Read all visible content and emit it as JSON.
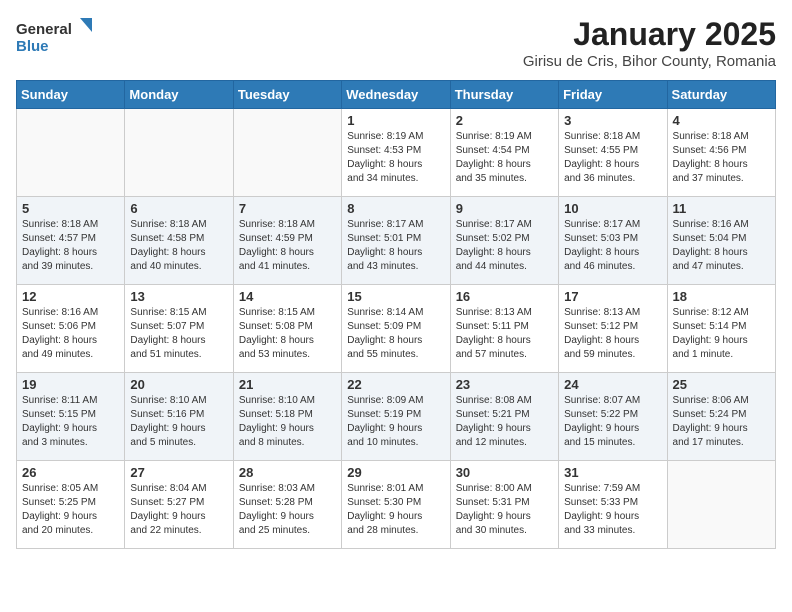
{
  "header": {
    "logo_general": "General",
    "logo_blue": "Blue",
    "month": "January 2025",
    "location": "Girisu de Cris, Bihor County, Romania"
  },
  "weekdays": [
    "Sunday",
    "Monday",
    "Tuesday",
    "Wednesday",
    "Thursday",
    "Friday",
    "Saturday"
  ],
  "weeks": [
    [
      {
        "day": "",
        "info": ""
      },
      {
        "day": "",
        "info": ""
      },
      {
        "day": "",
        "info": ""
      },
      {
        "day": "1",
        "info": "Sunrise: 8:19 AM\nSunset: 4:53 PM\nDaylight: 8 hours\nand 34 minutes."
      },
      {
        "day": "2",
        "info": "Sunrise: 8:19 AM\nSunset: 4:54 PM\nDaylight: 8 hours\nand 35 minutes."
      },
      {
        "day": "3",
        "info": "Sunrise: 8:18 AM\nSunset: 4:55 PM\nDaylight: 8 hours\nand 36 minutes."
      },
      {
        "day": "4",
        "info": "Sunrise: 8:18 AM\nSunset: 4:56 PM\nDaylight: 8 hours\nand 37 minutes."
      }
    ],
    [
      {
        "day": "5",
        "info": "Sunrise: 8:18 AM\nSunset: 4:57 PM\nDaylight: 8 hours\nand 39 minutes."
      },
      {
        "day": "6",
        "info": "Sunrise: 8:18 AM\nSunset: 4:58 PM\nDaylight: 8 hours\nand 40 minutes."
      },
      {
        "day": "7",
        "info": "Sunrise: 8:18 AM\nSunset: 4:59 PM\nDaylight: 8 hours\nand 41 minutes."
      },
      {
        "day": "8",
        "info": "Sunrise: 8:17 AM\nSunset: 5:01 PM\nDaylight: 8 hours\nand 43 minutes."
      },
      {
        "day": "9",
        "info": "Sunrise: 8:17 AM\nSunset: 5:02 PM\nDaylight: 8 hours\nand 44 minutes."
      },
      {
        "day": "10",
        "info": "Sunrise: 8:17 AM\nSunset: 5:03 PM\nDaylight: 8 hours\nand 46 minutes."
      },
      {
        "day": "11",
        "info": "Sunrise: 8:16 AM\nSunset: 5:04 PM\nDaylight: 8 hours\nand 47 minutes."
      }
    ],
    [
      {
        "day": "12",
        "info": "Sunrise: 8:16 AM\nSunset: 5:06 PM\nDaylight: 8 hours\nand 49 minutes."
      },
      {
        "day": "13",
        "info": "Sunrise: 8:15 AM\nSunset: 5:07 PM\nDaylight: 8 hours\nand 51 minutes."
      },
      {
        "day": "14",
        "info": "Sunrise: 8:15 AM\nSunset: 5:08 PM\nDaylight: 8 hours\nand 53 minutes."
      },
      {
        "day": "15",
        "info": "Sunrise: 8:14 AM\nSunset: 5:09 PM\nDaylight: 8 hours\nand 55 minutes."
      },
      {
        "day": "16",
        "info": "Sunrise: 8:13 AM\nSunset: 5:11 PM\nDaylight: 8 hours\nand 57 minutes."
      },
      {
        "day": "17",
        "info": "Sunrise: 8:13 AM\nSunset: 5:12 PM\nDaylight: 8 hours\nand 59 minutes."
      },
      {
        "day": "18",
        "info": "Sunrise: 8:12 AM\nSunset: 5:14 PM\nDaylight: 9 hours\nand 1 minute."
      }
    ],
    [
      {
        "day": "19",
        "info": "Sunrise: 8:11 AM\nSunset: 5:15 PM\nDaylight: 9 hours\nand 3 minutes."
      },
      {
        "day": "20",
        "info": "Sunrise: 8:10 AM\nSunset: 5:16 PM\nDaylight: 9 hours\nand 5 minutes."
      },
      {
        "day": "21",
        "info": "Sunrise: 8:10 AM\nSunset: 5:18 PM\nDaylight: 9 hours\nand 8 minutes."
      },
      {
        "day": "22",
        "info": "Sunrise: 8:09 AM\nSunset: 5:19 PM\nDaylight: 9 hours\nand 10 minutes."
      },
      {
        "day": "23",
        "info": "Sunrise: 8:08 AM\nSunset: 5:21 PM\nDaylight: 9 hours\nand 12 minutes."
      },
      {
        "day": "24",
        "info": "Sunrise: 8:07 AM\nSunset: 5:22 PM\nDaylight: 9 hours\nand 15 minutes."
      },
      {
        "day": "25",
        "info": "Sunrise: 8:06 AM\nSunset: 5:24 PM\nDaylight: 9 hours\nand 17 minutes."
      }
    ],
    [
      {
        "day": "26",
        "info": "Sunrise: 8:05 AM\nSunset: 5:25 PM\nDaylight: 9 hours\nand 20 minutes."
      },
      {
        "day": "27",
        "info": "Sunrise: 8:04 AM\nSunset: 5:27 PM\nDaylight: 9 hours\nand 22 minutes."
      },
      {
        "day": "28",
        "info": "Sunrise: 8:03 AM\nSunset: 5:28 PM\nDaylight: 9 hours\nand 25 minutes."
      },
      {
        "day": "29",
        "info": "Sunrise: 8:01 AM\nSunset: 5:30 PM\nDaylight: 9 hours\nand 28 minutes."
      },
      {
        "day": "30",
        "info": "Sunrise: 8:00 AM\nSunset: 5:31 PM\nDaylight: 9 hours\nand 30 minutes."
      },
      {
        "day": "31",
        "info": "Sunrise: 7:59 AM\nSunset: 5:33 PM\nDaylight: 9 hours\nand 33 minutes."
      },
      {
        "day": "",
        "info": ""
      }
    ]
  ]
}
